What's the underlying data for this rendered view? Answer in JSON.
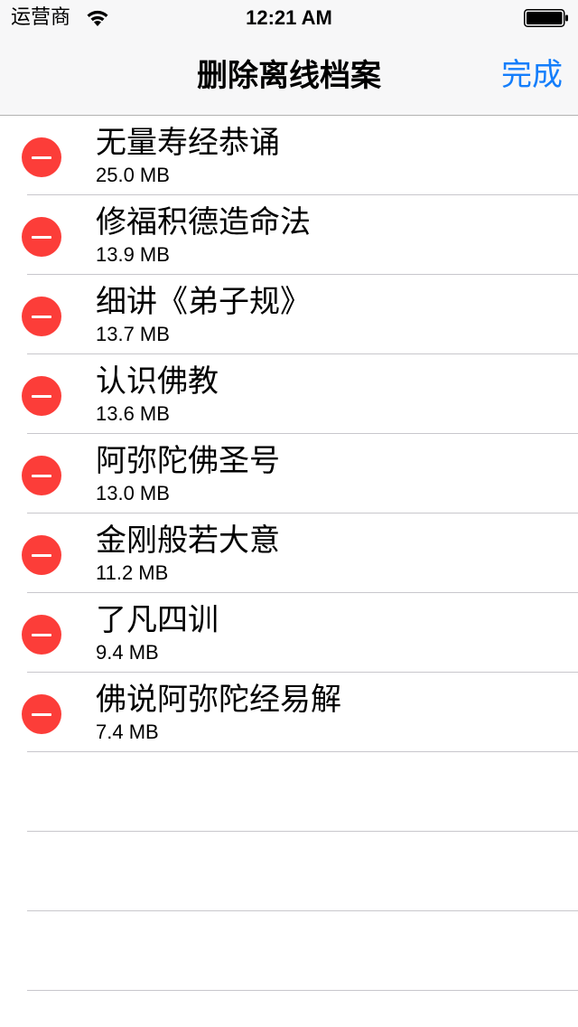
{
  "status_bar": {
    "carrier": "运营商",
    "time": "12:21 AM",
    "wifi_icon": "wifi-icon",
    "battery_icon": "battery-icon"
  },
  "nav_bar": {
    "title": "删除离线档案",
    "done_label": "完成"
  },
  "colors": {
    "accent": "#147efb",
    "delete": "#fc3d39",
    "separator": "#c8c7cc"
  },
  "items": [
    {
      "title": "无量寿经恭诵",
      "size": "25.0 MB"
    },
    {
      "title": "修福积德造命法",
      "size": "13.9 MB"
    },
    {
      "title": "细讲《弟子规》",
      "size": "13.7 MB"
    },
    {
      "title": "认识佛教",
      "size": "13.6 MB"
    },
    {
      "title": "阿弥陀佛圣号",
      "size": "13.0 MB"
    },
    {
      "title": "金刚般若大意",
      "size": "11.2 MB"
    },
    {
      "title": "了凡四训",
      "size": "9.4 MB"
    },
    {
      "title": "佛说阿弥陀经易解",
      "size": "7.4 MB"
    }
  ]
}
